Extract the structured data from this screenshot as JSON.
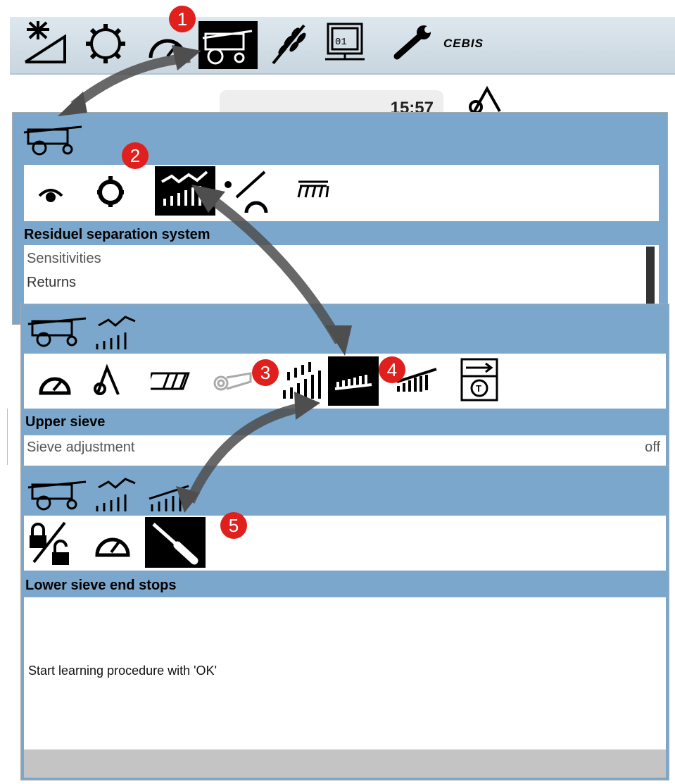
{
  "top_bar": {
    "icons": [
      "sun-slope-icon",
      "gear-icon",
      "gauge-icon",
      "combine-icon",
      "grain-icon",
      "computer-icon",
      "wrench-icon"
    ],
    "brand": "CEBIS"
  },
  "background": {
    "time": "15:57"
  },
  "panel1": {
    "tabs": [
      "eye-icon",
      "drum-icon",
      "separation-icon",
      "grain-loss-icon",
      "header-icon"
    ],
    "title": "Residuel separation system",
    "items": [
      "Sensitivities",
      "Returns"
    ]
  },
  "panel2": {
    "tabs": [
      "gauge-icon",
      "rotor-icon",
      "auger-icon",
      "fan-icon",
      "sieve-icon",
      "upper-sieve-icon",
      "lower-sieve-icon",
      "transmission-icon"
    ],
    "title": "Upper sieve",
    "row": {
      "label": "Sieve adjustment",
      "value": "off"
    }
  },
  "panel3": {
    "tabs": [
      "lock-icon",
      "gauge-icon",
      "screwdriver-icon"
    ],
    "title": "Lower sieve end stops",
    "message": "Start learning procedure with 'OK'"
  },
  "callouts": [
    "1",
    "2",
    "3",
    "4",
    "5"
  ],
  "colors": {
    "panel": "#7ba7cc",
    "badge": "#e0201c",
    "arrow": "#6d6d6d"
  }
}
